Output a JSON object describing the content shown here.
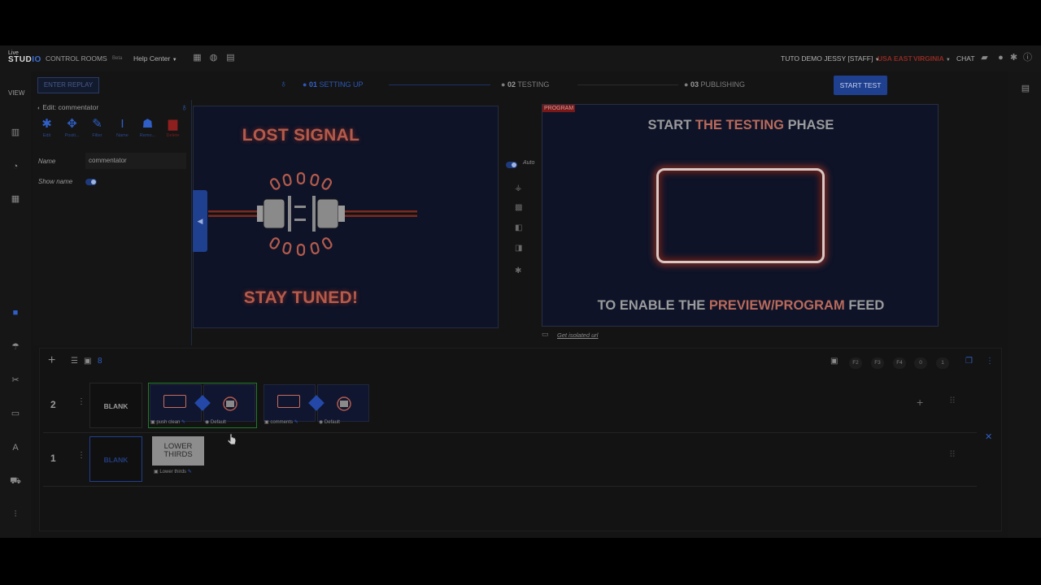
{
  "logo": {
    "line1": "Live",
    "line2a": "STUD",
    "line2b": "IO"
  },
  "topbar": {
    "control_rooms": "CONTROL ROOMS",
    "beta_tag": "Beta",
    "help_center": "Help Center",
    "account": "TUTO DEMO JESSY [STAFF]",
    "region": "USA EAST",
    "region_sub": "VIRGINIA",
    "chat": "CHAT"
  },
  "rail": {
    "view_label": "VIEW"
  },
  "stepper": {
    "enter_replay": "ENTER REPLAY",
    "steps": [
      {
        "num": "01",
        "label": "SETTING UP"
      },
      {
        "num": "02",
        "label": "TESTING"
      },
      {
        "num": "03",
        "label": "PUBLISHING"
      }
    ],
    "start_test": "START TEST"
  },
  "edit_panel": {
    "title": "Edit: commentator",
    "tools": [
      "Edit",
      "Positi...",
      "Filter",
      "Name",
      "Remo...",
      "Delete"
    ],
    "name_label": "Name",
    "name_value": "commentator",
    "show_name_label": "Show name",
    "show_name_on": true
  },
  "preview": {
    "lost_signal": "LOST SIGNAL",
    "stay_tuned": "STAY TUNED!"
  },
  "mid_controls": {
    "auto_label": "Auto",
    "auto_on": true
  },
  "program": {
    "tag": "PROGRAM",
    "line1_a": "START",
    "line1_b": "THE TESTING",
    "line1_c": "PHASE",
    "line2_a": "TO ENABLE THE",
    "line2_b": "PREVIEW/PROGRAM",
    "line2_c": "FEED",
    "get_isolated": "Get isolated url"
  },
  "rundown": {
    "fkeys": [
      "F2",
      "F3",
      "F4",
      "0",
      "1"
    ],
    "rows": [
      {
        "num": "2",
        "blank": "BLANK",
        "scene_a_label": "push clean",
        "scene_a_preset": "Default",
        "scene_b_label": "comments",
        "scene_b_preset": "Default"
      },
      {
        "num": "1",
        "blank": "BLANK",
        "lower_thirds_a": "LOWER",
        "lower_thirds_b": "THIRDS",
        "lower_label": "Lower thirds"
      }
    ]
  },
  "colors": {
    "accent": "#2f5fc7",
    "live": "#1f7a2b",
    "program": "#7a1717",
    "neon": "#b45b4c"
  }
}
